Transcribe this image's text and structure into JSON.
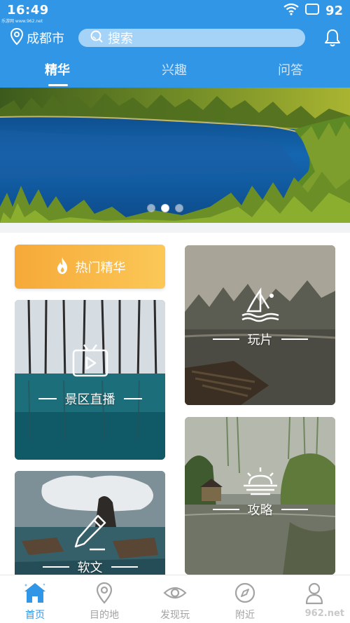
{
  "status_bar": {
    "time": "16:49",
    "watermark": "乐游网 www.962.net",
    "battery": "92"
  },
  "header": {
    "location": "成都市",
    "search_placeholder": "搜索",
    "tabs": [
      {
        "label": "精华",
        "active": true
      },
      {
        "label": "兴趣",
        "active": false
      },
      {
        "label": "问答",
        "active": false
      }
    ]
  },
  "banner": {
    "slides": 3,
    "active_index": 1
  },
  "cards": {
    "hot": {
      "label": "热门精华",
      "icon": "fire-icon"
    },
    "play": {
      "label": "玩片",
      "icon": "windsurf-icon"
    },
    "live": {
      "label": "景区直播",
      "icon": "tv-icon"
    },
    "guide": {
      "label": "攻略",
      "icon": "sunrise-icon"
    },
    "article": {
      "label": "软文",
      "icon": "pen-icon"
    }
  },
  "bottom_nav": [
    {
      "label": "首页",
      "icon": "home-icon",
      "active": true
    },
    {
      "label": "目的地",
      "icon": "location-pin-icon",
      "active": false
    },
    {
      "label": "发现玩",
      "icon": "eye-icon",
      "active": false
    },
    {
      "label": "附近",
      "icon": "compass-icon",
      "active": false
    },
    {
      "label": "",
      "icon": "user-icon",
      "active": false
    }
  ],
  "bottom_watermark": "962.net",
  "colors": {
    "primary": "#3196e6",
    "hot_gradient_start": "#f6a938",
    "hot_gradient_end": "#fbc857",
    "inactive_nav": "#a3a3a3"
  }
}
